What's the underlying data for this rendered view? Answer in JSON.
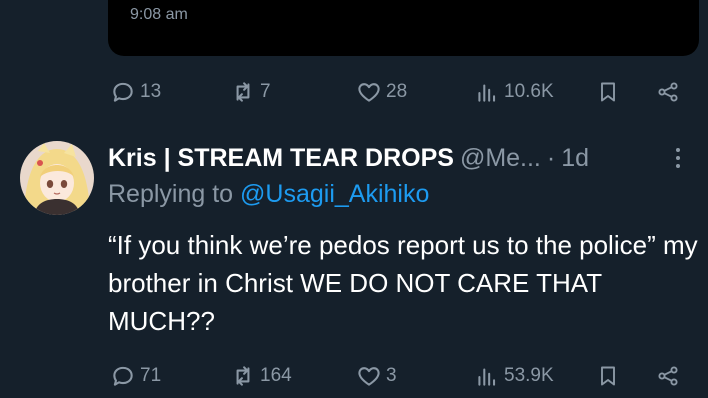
{
  "quoted": {
    "time": "9:08 am"
  },
  "stats_top": {
    "replies": "13",
    "reposts": "7",
    "likes": "28",
    "views": "10.6K"
  },
  "reply": {
    "display_name": "Kris | STREAM TEAR DROPS",
    "handle": "@Me...",
    "separator": "·",
    "time": "1d",
    "replying_prefix": "Replying to ",
    "replying_handle": "@Usagii_Akihiko",
    "text": "“If you think we’re pedos report us to the police” my brother in Christ WE DO NOT CARE THAT MUCH??"
  },
  "stats_bottom": {
    "replies": "71",
    "reposts": "164",
    "likes": "3",
    "views": "53.9K"
  },
  "colors": {
    "background": "#15202b",
    "muted": "#8b98a5",
    "link": "#1d9bf0",
    "card": "#000000"
  }
}
